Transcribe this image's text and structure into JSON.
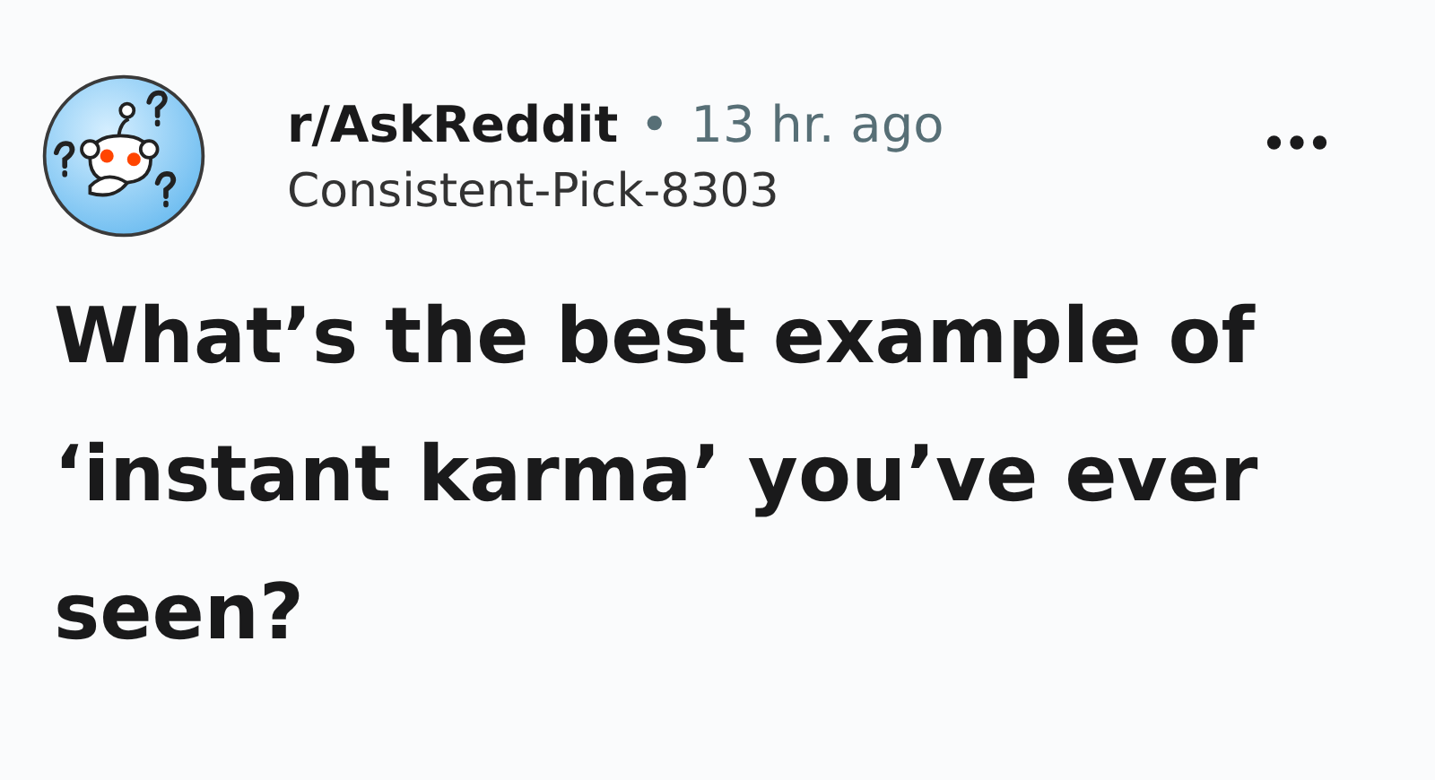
{
  "post": {
    "subreddit": "r/AskReddit",
    "separator": "•",
    "time": "13 hr. ago",
    "author": "Consistent-Pick-8303",
    "title": "What’s the best example of ‘instant karma’ you’ve ever seen?"
  }
}
